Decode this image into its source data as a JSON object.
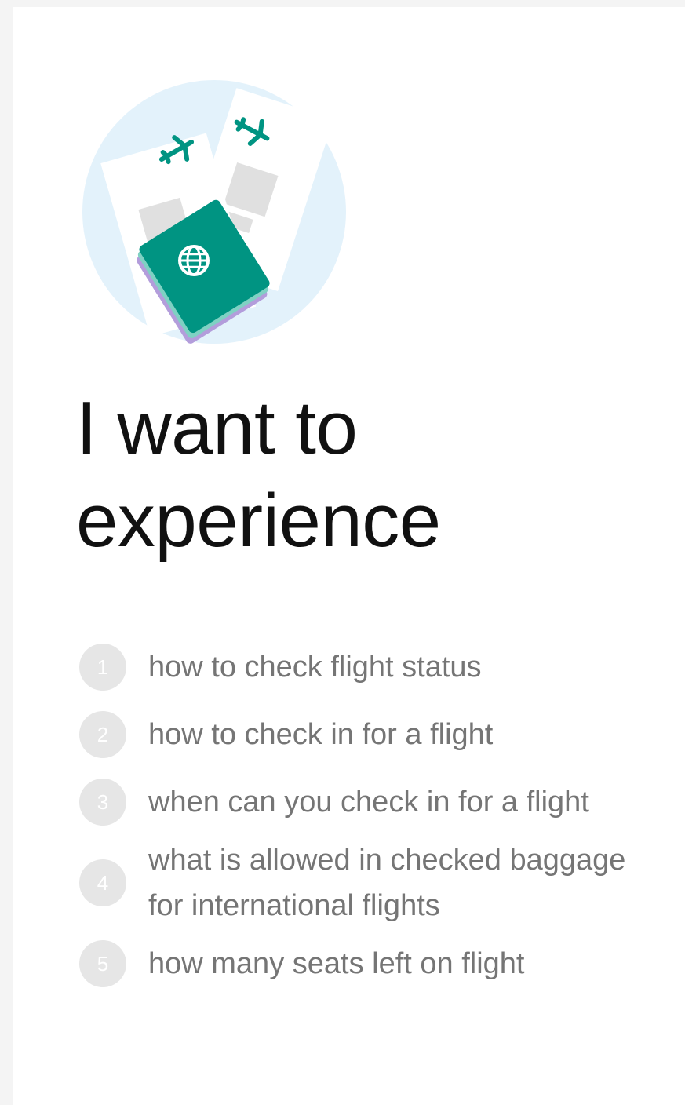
{
  "card": {
    "heading": "I want to\nexperience",
    "illustration": {
      "icons": [
        "airplane-icon",
        "airplane-icon",
        "globe-icon"
      ],
      "colors": {
        "circle": "#e3f2fb",
        "ticket": "#ffffff",
        "accent": "#009482",
        "placeholder": "#e0e0e0"
      }
    },
    "items": [
      {
        "number": "1",
        "text": "how to check flight status"
      },
      {
        "number": "2",
        "text": "how to check in for a flight"
      },
      {
        "number": "3",
        "text": "when can you check in for a flight"
      },
      {
        "number": "4",
        "text": "what is allowed in checked baggage for international flights"
      },
      {
        "number": "5",
        "text": "how many seats left on flight"
      }
    ]
  }
}
